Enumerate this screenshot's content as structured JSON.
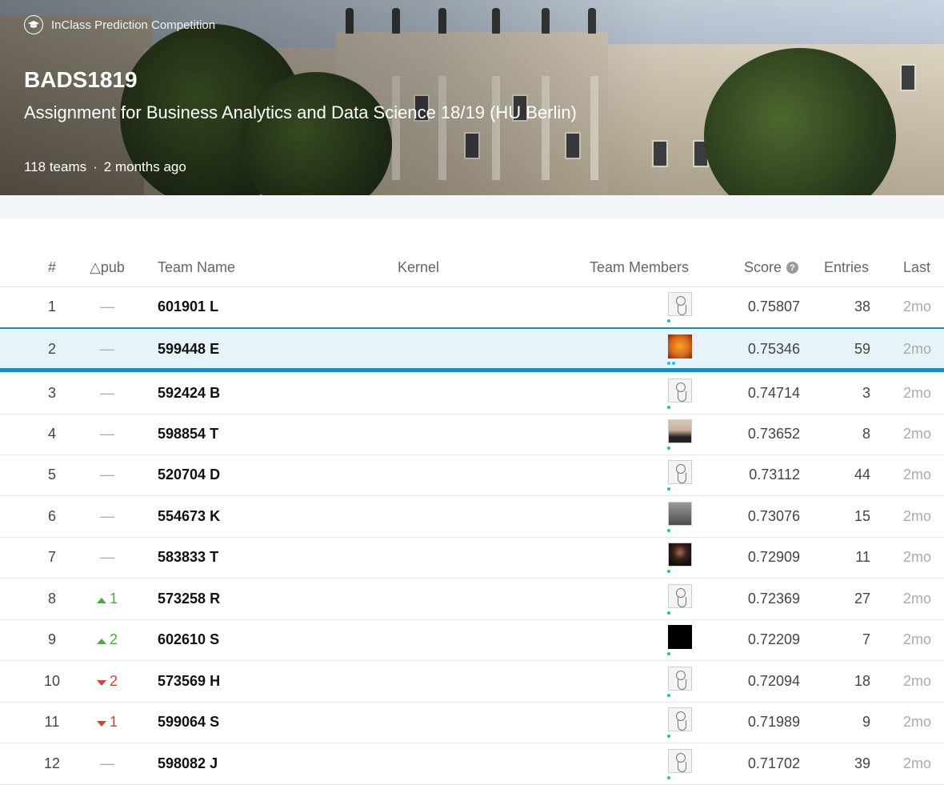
{
  "hero": {
    "competition_type": "InClass Prediction Competition",
    "title": "BADS1819",
    "subtitle": "Assignment for Business Analytics and Data Science 18/19 (HU Berlin)",
    "teams": "118 teams",
    "separator": "·",
    "age": "2 months ago"
  },
  "leaderboard": {
    "headers": {
      "rank": "#",
      "delta": "△pub",
      "team": "Team Name",
      "kernel": "Kernel",
      "members": "Team Members",
      "score": "Score",
      "entries": "Entries",
      "last": "Last"
    },
    "rows": [
      {
        "rank": "1",
        "delta": "—",
        "delta_dir": "none",
        "team": "601901 L",
        "avatar": "goose",
        "score": "0.75807",
        "entries": "38",
        "last": "2mo"
      },
      {
        "rank": "2",
        "delta": "—",
        "delta_dir": "none",
        "team": "599448 E",
        "avatar": "orange",
        "score": "0.75346",
        "entries": "59",
        "last": "2mo"
      },
      {
        "rank": "3",
        "delta": "—",
        "delta_dir": "none",
        "team": "592424 B",
        "avatar": "goose",
        "score": "0.74714",
        "entries": "3",
        "last": "2mo"
      },
      {
        "rank": "4",
        "delta": "—",
        "delta_dir": "none",
        "team": "598854 T",
        "avatar": "person",
        "score": "0.73652",
        "entries": "8",
        "last": "2mo"
      },
      {
        "rank": "5",
        "delta": "—",
        "delta_dir": "none",
        "team": "520704 D",
        "avatar": "goose",
        "score": "0.73112",
        "entries": "44",
        "last": "2mo"
      },
      {
        "rank": "6",
        "delta": "—",
        "delta_dir": "none",
        "team": "554673 K",
        "avatar": "gray",
        "score": "0.73076",
        "entries": "15",
        "last": "2mo"
      },
      {
        "rank": "7",
        "delta": "—",
        "delta_dir": "none",
        "team": "583833 T",
        "avatar": "dark",
        "score": "0.72909",
        "entries": "11",
        "last": "2mo"
      },
      {
        "rank": "8",
        "delta": "1",
        "delta_dir": "up",
        "team": "573258 R",
        "avatar": "goose",
        "score": "0.72369",
        "entries": "27",
        "last": "2mo"
      },
      {
        "rank": "9",
        "delta": "2",
        "delta_dir": "up",
        "team": "602610 S",
        "avatar": "black",
        "score": "0.72209",
        "entries": "7",
        "last": "2mo"
      },
      {
        "rank": "10",
        "delta": "2",
        "delta_dir": "down",
        "team": "573569 H",
        "avatar": "goose",
        "score": "0.72094",
        "entries": "18",
        "last": "2mo"
      },
      {
        "rank": "11",
        "delta": "1",
        "delta_dir": "down",
        "team": "599064 S",
        "avatar": "goose",
        "score": "0.71989",
        "entries": "9",
        "last": "2mo"
      },
      {
        "rank": "12",
        "delta": "—",
        "delta_dir": "none",
        "team": "598082 J",
        "avatar": "goose",
        "score": "0.71702",
        "entries": "39",
        "last": "2mo"
      }
    ]
  },
  "colors": {
    "accent": "#1c8cbc",
    "highlight_row": "#e6f4f9",
    "up": "#52a447",
    "down": "#c9473b"
  }
}
